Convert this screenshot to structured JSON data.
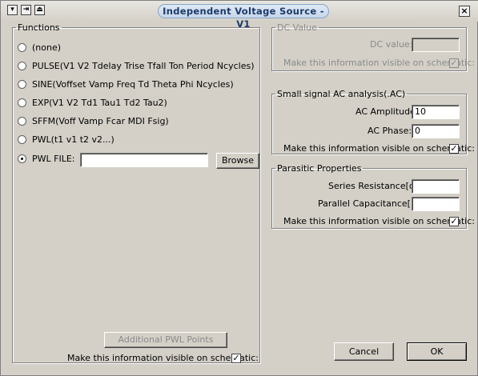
{
  "window": {
    "title": "Independent Voltage Source - V1",
    "icons": [
      "menu-arrow-icon",
      "pin-icon",
      "minimize-icon",
      "close-icon"
    ]
  },
  "functions": {
    "legend": "Functions",
    "options": [
      {
        "label": "(none)",
        "selected": false
      },
      {
        "label": "PULSE(V1 V2 Tdelay Trise Tfall Ton Period Ncycles)",
        "selected": false
      },
      {
        "label": "SINE(Voffset Vamp Freq Td Theta Phi Ncycles)",
        "selected": false
      },
      {
        "label": "EXP(V1 V2 Td1 Tau1 Td2 Tau2)",
        "selected": false
      },
      {
        "label": "SFFM(Voff Vamp Fcar MDI Fsig)",
        "selected": false
      },
      {
        "label": "PWL(t1 v1 t2 v2...)",
        "selected": false
      },
      {
        "label": "PWL FILE:",
        "selected": true
      }
    ],
    "pwl_file_value": "",
    "browse_label": "Browse",
    "additional_pwl_label": "Additional PWL Points",
    "visible_label": "Make this information visible on schematic:",
    "visible_checked": true
  },
  "dc": {
    "legend": "DC Value",
    "value_label": "DC value:",
    "value": "",
    "visible_label": "Make this information visible on schematic:",
    "visible_checked": true
  },
  "ac": {
    "legend": "Small signal AC analysis(.AC)",
    "amplitude_label": "AC Amplitude:",
    "amplitude_value": "10",
    "phase_label": "AC Phase:",
    "phase_value": "0",
    "visible_label": "Make this information visible on schematic:",
    "visible_checked": true
  },
  "parasitic": {
    "legend": "Parasitic Properties",
    "series_label": "Series Resistance[o",
    "series_value": "",
    "parallel_label": "Parallel Capacitance[F]:",
    "parallel_value": "",
    "visible_label": "Make this information visible on schematic:",
    "visible_checked": true
  },
  "buttons": {
    "cancel": "Cancel",
    "ok": "OK"
  },
  "glyphs": {
    "check": "✓",
    "close": "×",
    "menu": "▾",
    "pin": "⇥",
    "minimize": "⏏"
  }
}
